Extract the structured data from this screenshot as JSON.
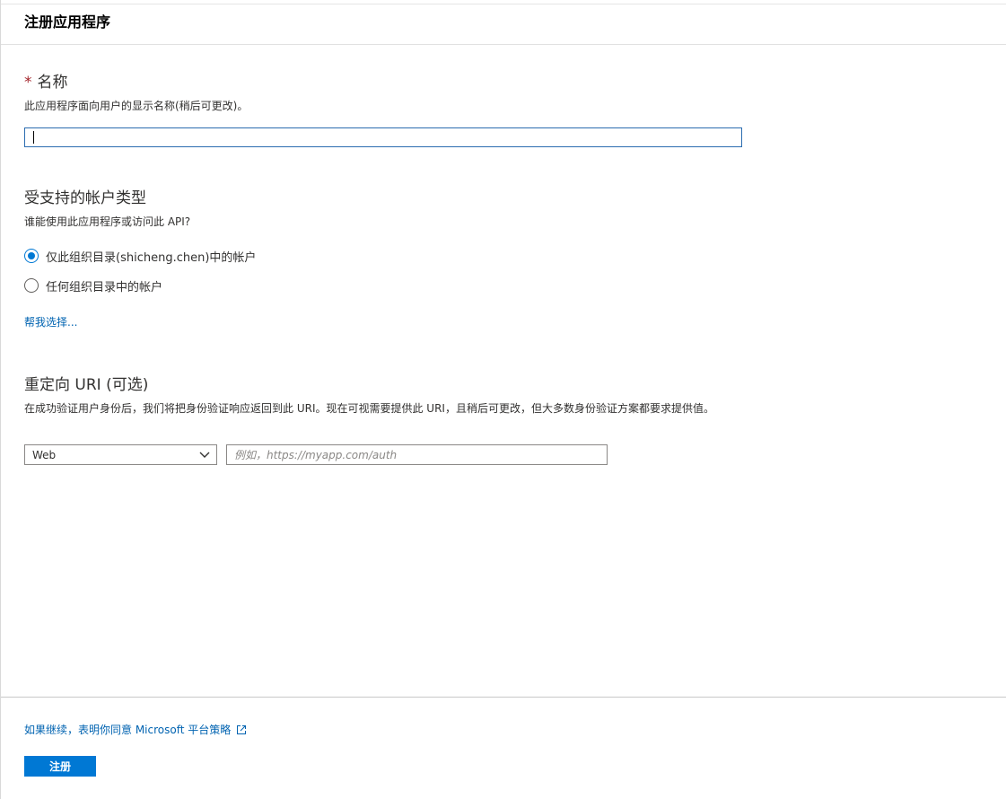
{
  "header": {
    "title": "注册应用程序"
  },
  "name_section": {
    "required_mark": "*",
    "title": "名称",
    "description": "此应用程序面向用户的显示名称(稍后可更改)。",
    "value": ""
  },
  "account_section": {
    "title": "受支持的帐户类型",
    "question": "谁能使用此应用程序或访问此 API?",
    "options": [
      {
        "label": "仅此组织目录(shicheng.chen)中的帐户",
        "checked": true
      },
      {
        "label": "任何组织目录中的帐户",
        "checked": false
      }
    ],
    "help_link": "帮我选择..."
  },
  "redirect_section": {
    "title": "重定向 URI (可选)",
    "description": "在成功验证用户身份后，我们将把身份验证响应返回到此 URI。现在可视需要提供此 URI，且稍后可更改，但大多数身份验证方案都要求提供值。",
    "platform_value": "Web",
    "uri_placeholder": "例如，https://myapp.com/auth"
  },
  "footer": {
    "consent_link": "如果继续，表明你同意 Microsoft 平台策略",
    "register_label": "注册"
  },
  "colors": {
    "accent": "#0078d4",
    "link": "#0063b1",
    "required": "#a4262c"
  },
  "icons": {
    "platform_dropdown": "chevron-down-icon",
    "consent_link": "external-link-icon"
  }
}
